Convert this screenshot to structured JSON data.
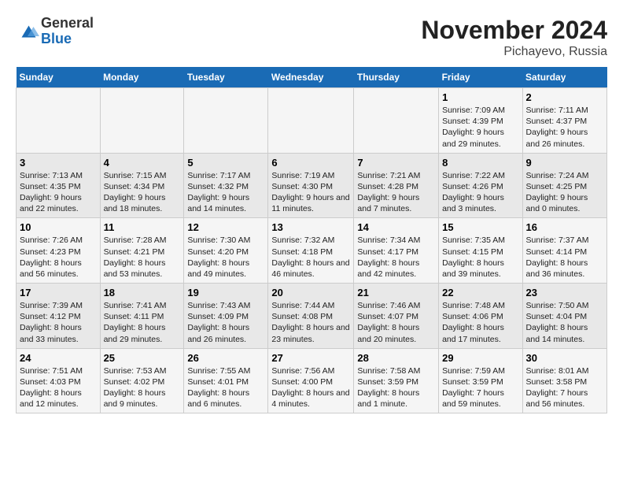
{
  "header": {
    "logo_line1": "General",
    "logo_line2": "Blue",
    "title": "November 2024",
    "subtitle": "Pichayevo, Russia"
  },
  "days_of_week": [
    "Sunday",
    "Monday",
    "Tuesday",
    "Wednesday",
    "Thursday",
    "Friday",
    "Saturday"
  ],
  "weeks": [
    [
      {
        "day": "",
        "info": ""
      },
      {
        "day": "",
        "info": ""
      },
      {
        "day": "",
        "info": ""
      },
      {
        "day": "",
        "info": ""
      },
      {
        "day": "",
        "info": ""
      },
      {
        "day": "1",
        "info": "Sunrise: 7:09 AM\nSunset: 4:39 PM\nDaylight: 9 hours and 29 minutes."
      },
      {
        "day": "2",
        "info": "Sunrise: 7:11 AM\nSunset: 4:37 PM\nDaylight: 9 hours and 26 minutes."
      }
    ],
    [
      {
        "day": "3",
        "info": "Sunrise: 7:13 AM\nSunset: 4:35 PM\nDaylight: 9 hours and 22 minutes."
      },
      {
        "day": "4",
        "info": "Sunrise: 7:15 AM\nSunset: 4:34 PM\nDaylight: 9 hours and 18 minutes."
      },
      {
        "day": "5",
        "info": "Sunrise: 7:17 AM\nSunset: 4:32 PM\nDaylight: 9 hours and 14 minutes."
      },
      {
        "day": "6",
        "info": "Sunrise: 7:19 AM\nSunset: 4:30 PM\nDaylight: 9 hours and 11 minutes."
      },
      {
        "day": "7",
        "info": "Sunrise: 7:21 AM\nSunset: 4:28 PM\nDaylight: 9 hours and 7 minutes."
      },
      {
        "day": "8",
        "info": "Sunrise: 7:22 AM\nSunset: 4:26 PM\nDaylight: 9 hours and 3 minutes."
      },
      {
        "day": "9",
        "info": "Sunrise: 7:24 AM\nSunset: 4:25 PM\nDaylight: 9 hours and 0 minutes."
      }
    ],
    [
      {
        "day": "10",
        "info": "Sunrise: 7:26 AM\nSunset: 4:23 PM\nDaylight: 8 hours and 56 minutes."
      },
      {
        "day": "11",
        "info": "Sunrise: 7:28 AM\nSunset: 4:21 PM\nDaylight: 8 hours and 53 minutes."
      },
      {
        "day": "12",
        "info": "Sunrise: 7:30 AM\nSunset: 4:20 PM\nDaylight: 8 hours and 49 minutes."
      },
      {
        "day": "13",
        "info": "Sunrise: 7:32 AM\nSunset: 4:18 PM\nDaylight: 8 hours and 46 minutes."
      },
      {
        "day": "14",
        "info": "Sunrise: 7:34 AM\nSunset: 4:17 PM\nDaylight: 8 hours and 42 minutes."
      },
      {
        "day": "15",
        "info": "Sunrise: 7:35 AM\nSunset: 4:15 PM\nDaylight: 8 hours and 39 minutes."
      },
      {
        "day": "16",
        "info": "Sunrise: 7:37 AM\nSunset: 4:14 PM\nDaylight: 8 hours and 36 minutes."
      }
    ],
    [
      {
        "day": "17",
        "info": "Sunrise: 7:39 AM\nSunset: 4:12 PM\nDaylight: 8 hours and 33 minutes."
      },
      {
        "day": "18",
        "info": "Sunrise: 7:41 AM\nSunset: 4:11 PM\nDaylight: 8 hours and 29 minutes."
      },
      {
        "day": "19",
        "info": "Sunrise: 7:43 AM\nSunset: 4:09 PM\nDaylight: 8 hours and 26 minutes."
      },
      {
        "day": "20",
        "info": "Sunrise: 7:44 AM\nSunset: 4:08 PM\nDaylight: 8 hours and 23 minutes."
      },
      {
        "day": "21",
        "info": "Sunrise: 7:46 AM\nSunset: 4:07 PM\nDaylight: 8 hours and 20 minutes."
      },
      {
        "day": "22",
        "info": "Sunrise: 7:48 AM\nSunset: 4:06 PM\nDaylight: 8 hours and 17 minutes."
      },
      {
        "day": "23",
        "info": "Sunrise: 7:50 AM\nSunset: 4:04 PM\nDaylight: 8 hours and 14 minutes."
      }
    ],
    [
      {
        "day": "24",
        "info": "Sunrise: 7:51 AM\nSunset: 4:03 PM\nDaylight: 8 hours and 12 minutes."
      },
      {
        "day": "25",
        "info": "Sunrise: 7:53 AM\nSunset: 4:02 PM\nDaylight: 8 hours and 9 minutes."
      },
      {
        "day": "26",
        "info": "Sunrise: 7:55 AM\nSunset: 4:01 PM\nDaylight: 8 hours and 6 minutes."
      },
      {
        "day": "27",
        "info": "Sunrise: 7:56 AM\nSunset: 4:00 PM\nDaylight: 8 hours and 4 minutes."
      },
      {
        "day": "28",
        "info": "Sunrise: 7:58 AM\nSunset: 3:59 PM\nDaylight: 8 hours and 1 minute."
      },
      {
        "day": "29",
        "info": "Sunrise: 7:59 AM\nSunset: 3:59 PM\nDaylight: 7 hours and 59 minutes."
      },
      {
        "day": "30",
        "info": "Sunrise: 8:01 AM\nSunset: 3:58 PM\nDaylight: 7 hours and 56 minutes."
      }
    ]
  ]
}
